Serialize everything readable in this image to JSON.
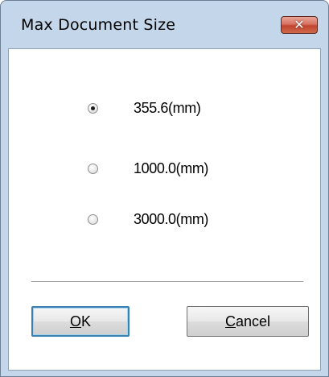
{
  "window": {
    "title": "Max Document Size",
    "close_glyph": "✕"
  },
  "options": {
    "selected_index": 0,
    "items": [
      {
        "label": "355.6(mm)"
      },
      {
        "label": "1000.0(mm)"
      },
      {
        "label": "3000.0(mm)"
      }
    ]
  },
  "buttons": {
    "ok_mnemonic": "O",
    "ok_rest": "K",
    "cancel_mnemonic": "C",
    "cancel_rest": "ancel"
  },
  "colors": {
    "title_bar": "#c3d6ea",
    "close_button": "#c1432e",
    "default_button_border": "#3c7fb1"
  },
  "icons": {
    "close": "close-icon",
    "radio": "radio-button-icon"
  }
}
